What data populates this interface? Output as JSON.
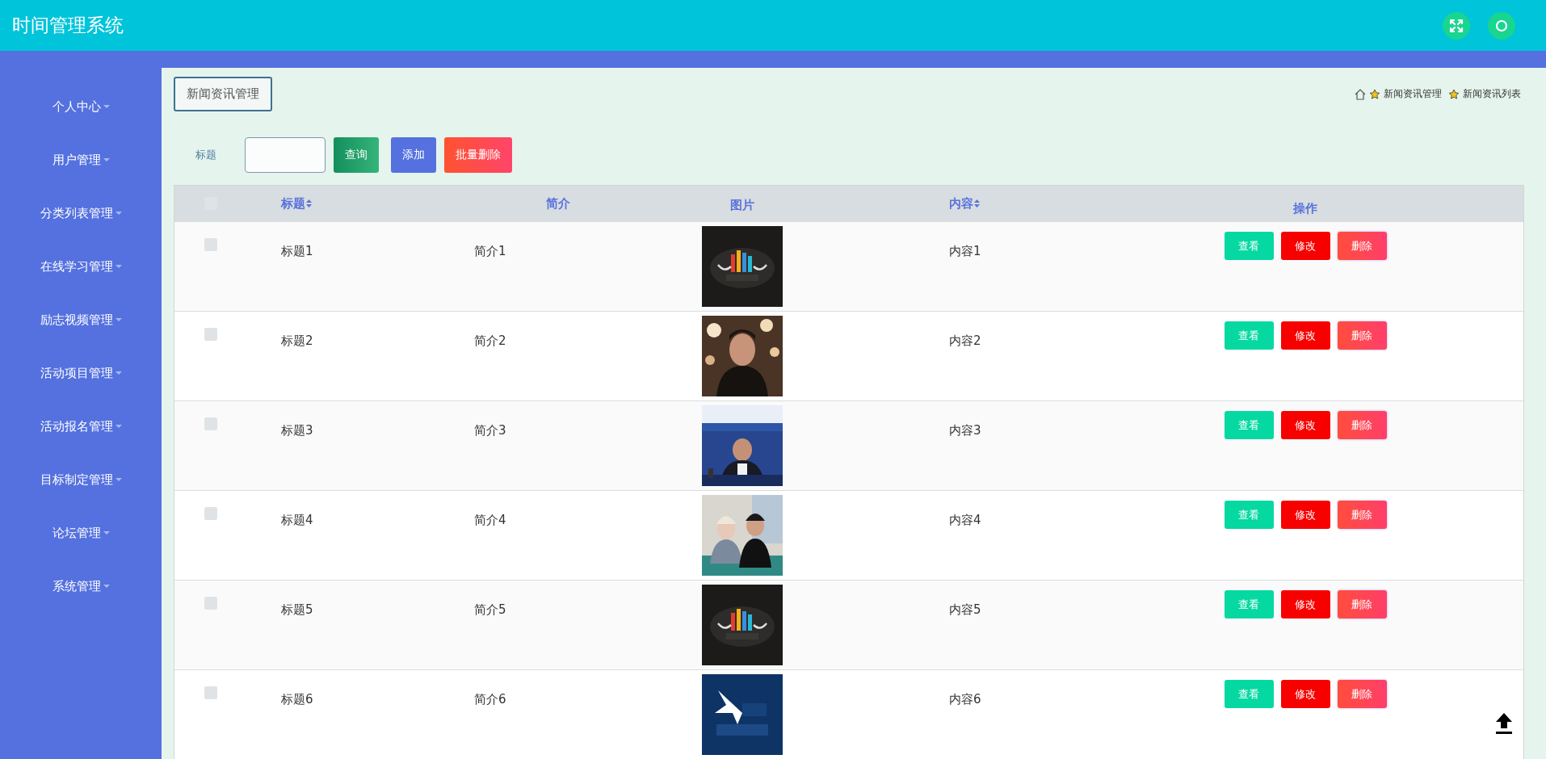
{
  "header": {
    "title": "时间管理系统"
  },
  "sidebar": {
    "items": [
      {
        "label": "个人中心"
      },
      {
        "label": "用户管理"
      },
      {
        "label": "分类列表管理"
      },
      {
        "label": "在线学习管理"
      },
      {
        "label": "励志视频管理"
      },
      {
        "label": "活动项目管理"
      },
      {
        "label": "活动报名管理"
      },
      {
        "label": "目标制定管理"
      },
      {
        "label": "论坛管理"
      },
      {
        "label": "系统管理"
      }
    ]
  },
  "page_title": "新闻资讯管理",
  "breadcrumb": [
    "新闻资讯管理",
    "新闻资讯列表"
  ],
  "search": {
    "label": "标题"
  },
  "toolbar_buttons": [
    {
      "label": "查询",
      "kind": "search"
    },
    {
      "label": "添加",
      "kind": "add"
    },
    {
      "label": "批量删除",
      "kind": "delete"
    }
  ],
  "table": {
    "all_checked": false,
    "columns": [
      {
        "label": "标题",
        "sortable": true
      },
      {
        "label": "简介",
        "sortable": false
      },
      {
        "label": "图片",
        "sortable": false
      },
      {
        "label": "内容",
        "sortable": true
      },
      {
        "label": "操作",
        "sortable": false
      }
    ],
    "rows": [
      {
        "checked": false,
        "title": "标题1",
        "intro": "简介1",
        "content": "内容1",
        "actions": [
          {
            "label": "查看",
            "kind": "view"
          },
          {
            "label": "修改",
            "kind": "edit"
          },
          {
            "label": "删除",
            "kind": "delete"
          }
        ]
      },
      {
        "checked": false,
        "title": "标题2",
        "intro": "简介2",
        "content": "内容2",
        "actions": [
          {
            "label": "查看",
            "kind": "view"
          },
          {
            "label": "修改",
            "kind": "edit"
          },
          {
            "label": "删除",
            "kind": "delete"
          }
        ]
      },
      {
        "checked": false,
        "title": "标题3",
        "intro": "简介3",
        "content": "内容3",
        "actions": [
          {
            "label": "查看",
            "kind": "view"
          },
          {
            "label": "修改",
            "kind": "edit"
          },
          {
            "label": "删除",
            "kind": "delete"
          }
        ]
      },
      {
        "checked": false,
        "title": "标题4",
        "intro": "简介4",
        "content": "内容4",
        "actions": [
          {
            "label": "查看",
            "kind": "view"
          },
          {
            "label": "修改",
            "kind": "edit"
          },
          {
            "label": "删除",
            "kind": "delete"
          }
        ]
      },
      {
        "checked": false,
        "title": "标题5",
        "intro": "简介5",
        "content": "内容5",
        "actions": [
          {
            "label": "查看",
            "kind": "view"
          },
          {
            "label": "修改",
            "kind": "edit"
          },
          {
            "label": "删除",
            "kind": "delete"
          }
        ]
      },
      {
        "checked": false,
        "title": "标题6",
        "intro": "简介6",
        "content": "内容6",
        "actions": [
          {
            "label": "查看",
            "kind": "view"
          },
          {
            "label": "修改",
            "kind": "edit"
          },
          {
            "label": "删除",
            "kind": "delete"
          }
        ]
      }
    ]
  }
}
